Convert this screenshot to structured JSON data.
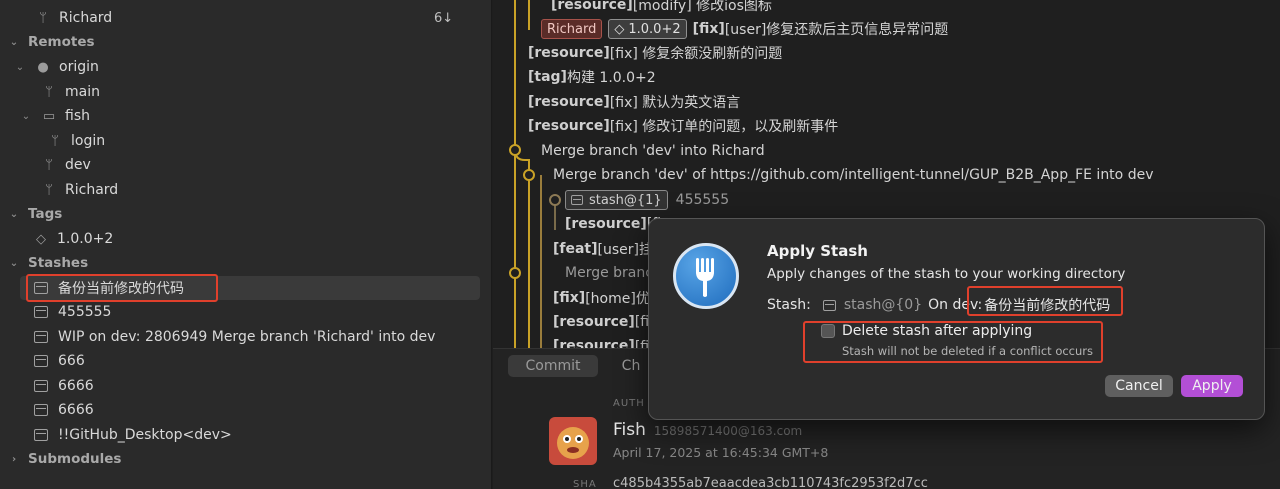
{
  "sidebar": {
    "top_branch": {
      "label": "Richard",
      "count": "6↓"
    },
    "remotes": {
      "header": "Remotes",
      "origin": "origin",
      "main": "main",
      "fish_folder": "fish",
      "login": "login",
      "dev": "dev",
      "richard": "Richard"
    },
    "tags": {
      "header": "Tags",
      "items": [
        "1.0.0+2"
      ]
    },
    "stashes": {
      "header": "Stashes",
      "items": [
        "备份当前修改的代码",
        "455555",
        "WIP on dev: 2806949 Merge branch 'Richard' into dev",
        "666",
        "6666",
        "6666",
        "!!GitHub_Desktop<dev>"
      ]
    },
    "submodules": {
      "header": "Submodules"
    }
  },
  "commits": [
    {
      "kw": "[resource]",
      "text": "[modify] 修改ios图标"
    },
    {
      "branch": "Richard",
      "tag": "1.0.0+2",
      "kw": "[fix]",
      "text": "[user]修复还款后主页信息异常问题"
    },
    {
      "kw": "[resource]",
      "text": "[fix] 修复余额没刷新的问题"
    },
    {
      "kw": "[tag]",
      "text": " 构建 1.0.0+2"
    },
    {
      "kw": "[resource]",
      "text": "[fix] 默认为英文语言"
    },
    {
      "kw": "[resource]",
      "text": "[fix] 修改订单的问题，以及刷新事件"
    },
    {
      "text": "Merge branch 'dev' into Richard"
    },
    {
      "text": "Merge branch 'dev' of https://github.com/intelligent-tunnel/GUP_B2B_App_FE into dev"
    },
    {
      "stash": "stash@{1}",
      "text": "455555"
    },
    {
      "kw": "[resource]",
      "text": "[fix"
    },
    {
      "kw": "[feat]",
      "text": "[user]挂账"
    },
    {
      "text": "Merge branc"
    },
    {
      "kw": "[fix]",
      "text": "[home]优化"
    },
    {
      "kw": "[resource]",
      "text": "[fix]"
    },
    {
      "kw": "[resource]",
      "text": "[fix] 优"
    }
  ],
  "lower": {
    "tabs": [
      "Commit",
      "Ch"
    ],
    "author_label": "AUTH",
    "author_name": "Fish",
    "author_email": "15898571400@163.com",
    "date": "April 17, 2025 at 16:45:34 GMT+8",
    "sha_label": "SHA",
    "sha": "c485b4355ab7eaacdea3cb110743fc2953f2d7cc"
  },
  "dialog": {
    "title": "Apply Stash",
    "subtitle": "Apply changes of the stash to your working directory",
    "stash_label": "Stash:",
    "stash_ref": "stash@{0}",
    "on_label": "On dev:",
    "stash_message": "备份当前修改的代码",
    "checkbox_label": "Delete stash after applying",
    "checkbox_hint": "Stash will not be deleted if a conflict occurs",
    "checkbox_checked": false,
    "cancel_label": "Cancel",
    "apply_label": "Apply",
    "apply_color": "#b34fd6"
  }
}
